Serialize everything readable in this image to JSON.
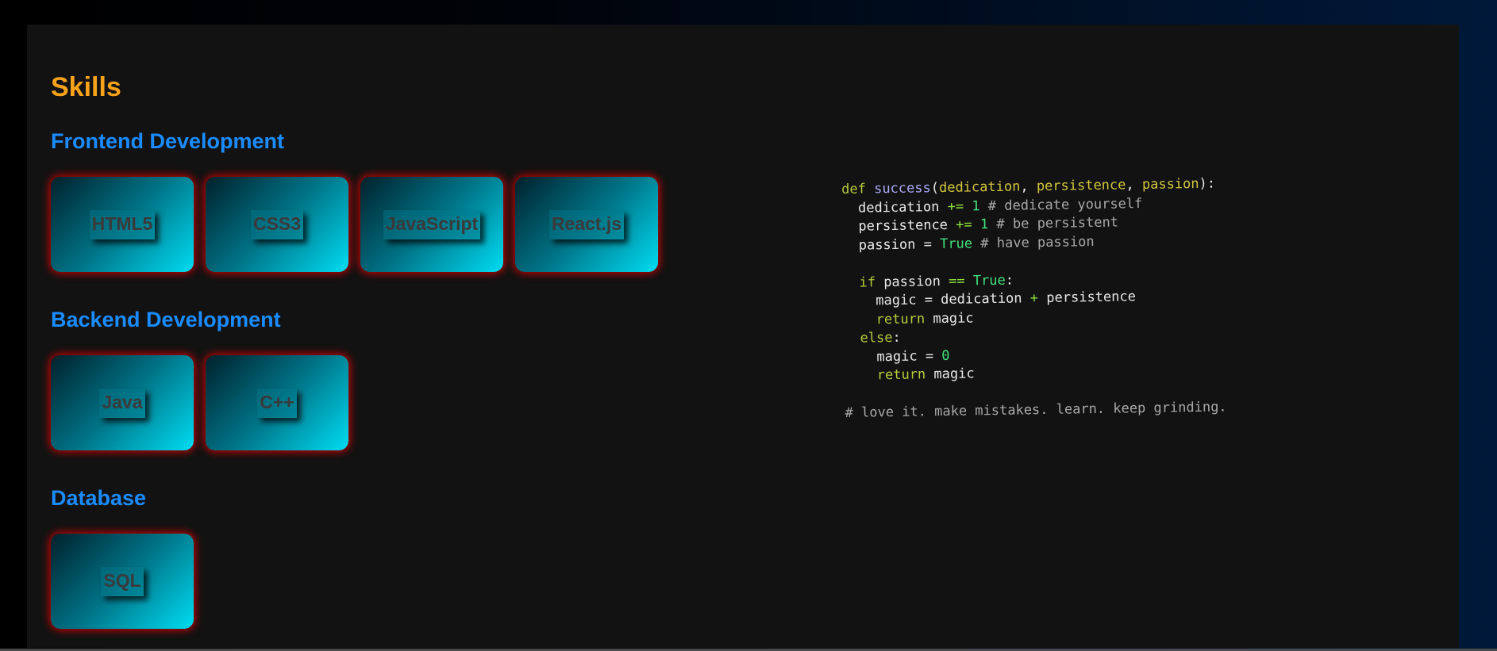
{
  "skills": {
    "title": "Skills",
    "groups": [
      {
        "title": "Frontend Development",
        "items": [
          "HTML5",
          "CSS3",
          "JavaScript",
          "React.js"
        ]
      },
      {
        "title": "Backend Development",
        "items": [
          "Java",
          "C++"
        ]
      },
      {
        "title": "Database",
        "items": [
          "SQL"
        ]
      }
    ]
  },
  "code": {
    "def": "def",
    "fn_name": "success",
    "param1": "dedication",
    "param2": "persistence",
    "param3": "passion",
    "comment1": "# dedicate yourself",
    "comment2": "# be persistent",
    "comment3": "# have passion",
    "var_magic": "magic",
    "kw_if": "if",
    "kw_else": "else",
    "kw_return": "return",
    "bool_true": "True",
    "one": "1",
    "zero": "0",
    "closing_comment": "# love it. make mistakes. learn. keep grinding."
  },
  "colors": {
    "heading": "#f7a21b",
    "group_heading": "#1a8cff",
    "card_glow": "#e60000",
    "card_gradient_end": "#00dcf2"
  }
}
